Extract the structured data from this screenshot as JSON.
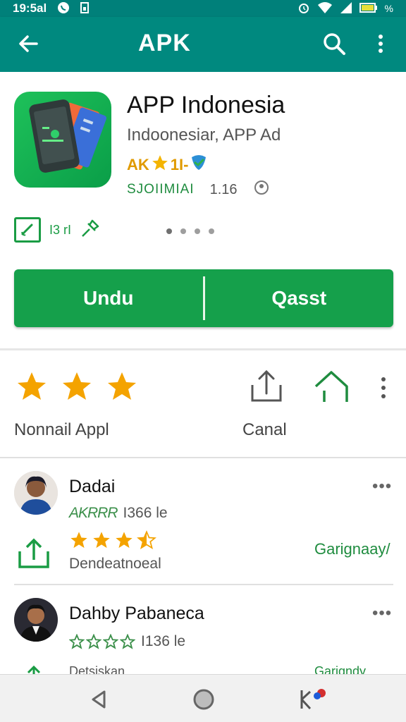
{
  "status_bar": {
    "time": "19:5al",
    "icons": [
      "whatsapp-icon",
      "sim-icon",
      "alarm-icon",
      "wifi-icon",
      "signal-icon",
      "battery-icon"
    ],
    "battery_text": "%"
  },
  "app_bar": {
    "title": "APK",
    "accent_color": "#00897f"
  },
  "app": {
    "name": "APP Indonesia",
    "developer": "Indoonesiar, APP Ad",
    "rating_text": "AK",
    "rating_suffix": "1I-",
    "category": "SJOIIMIAI",
    "version": "1.16",
    "badge_text": "I3 rI",
    "install_label": "Undu",
    "secondary_label": "Qasst",
    "accent_color": "#15a04b"
  },
  "actions": {
    "stars_label": "Nonnail Appl",
    "share_label": "Canal"
  },
  "reviews": [
    {
      "name": "Dadai",
      "stars_text": "AKRRR",
      "count_text": "I366 le",
      "sub_text": "Dendeatnoeal",
      "link_text": "Garignaay/",
      "user_stars": 3.5
    },
    {
      "name": "Dahby Pabaneca",
      "stars_text": "",
      "count_text": "I136 le",
      "sub_text": "Detsiskan",
      "link_text": "Garigndy"
    }
  ]
}
